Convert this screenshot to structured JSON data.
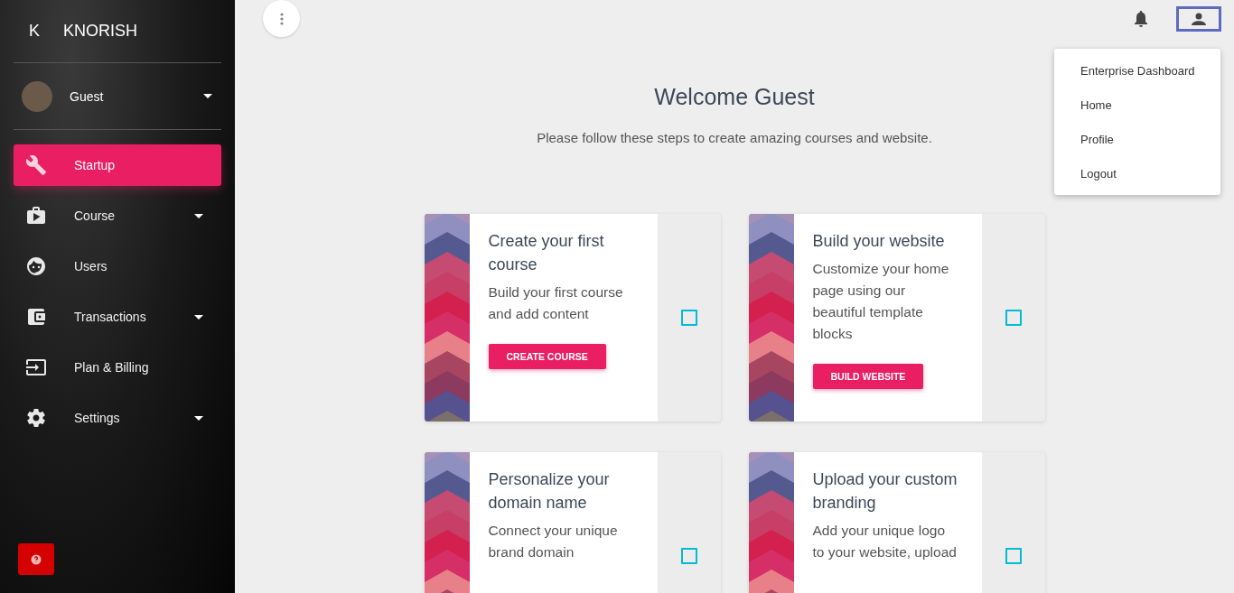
{
  "brand": {
    "mark": "K",
    "name": "KNORISH"
  },
  "user": {
    "name": "Guest"
  },
  "sidebar": {
    "items": [
      {
        "label": "Startup",
        "kind": "link",
        "selected": true
      },
      {
        "label": "Course",
        "kind": "dropdown",
        "selected": false
      },
      {
        "label": "Users",
        "kind": "link",
        "selected": false
      },
      {
        "label": "Transactions",
        "kind": "dropdown",
        "selected": false
      },
      {
        "label": "Plan & Billing",
        "kind": "link",
        "selected": false
      },
      {
        "label": "Settings",
        "kind": "dropdown",
        "selected": false
      }
    ]
  },
  "user_menu": {
    "items": [
      "Enterprise Dashboard",
      "Home",
      "Profile",
      "Logout"
    ]
  },
  "welcome": {
    "title": "Welcome Guest",
    "subtitle": "Please follow these steps to create amazing courses and website."
  },
  "steps": [
    {
      "title": "Create your first course",
      "description": "Build your first course and add content",
      "button": "CREATE COURSE",
      "checked": false
    },
    {
      "title": "Build your website",
      "description": "Customize your home page using our beautiful template blocks",
      "button": "BUILD WEBSITE",
      "checked": false
    },
    {
      "title": "Personalize your domain name",
      "description": "Connect your unique brand domain",
      "checked": false
    },
    {
      "title": "Upload your custom branding",
      "description": "Add your unique logo to your website, upload",
      "checked": false
    }
  ]
}
